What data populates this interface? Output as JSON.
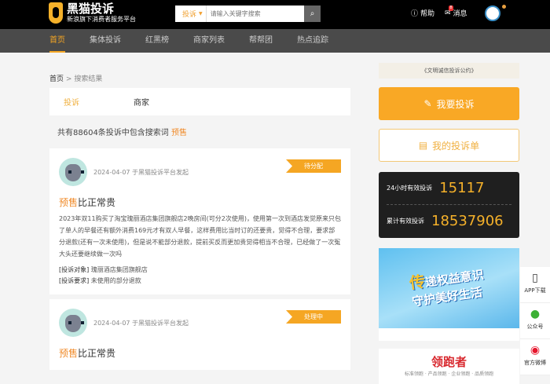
{
  "header": {
    "logo_title": "黑猫投诉",
    "logo_subtitle": "新浪旗下消费者服务平台",
    "search_type": "投诉",
    "search_placeholder": "请输入关键字搜索",
    "help": "帮助",
    "messages": "消息",
    "message_count": "8"
  },
  "nav": [
    "首页",
    "集体投诉",
    "红黑榜",
    "商家列表",
    "帮帮团",
    "热点追踪"
  ],
  "breadcrumb": {
    "home": "首页",
    "sep": ">",
    "current": "搜索结果"
  },
  "tabs": [
    "投诉",
    "商家"
  ],
  "result_count": {
    "prefix": "共有88604条投诉中包含搜索词",
    "keyword": "预售"
  },
  "complaints": [
    {
      "date": "2024-04-07 于黑猫投诉平台发起",
      "status": "待分配",
      "title_hl": "预售",
      "title_rest": "比正常贵",
      "body": "2023年双11购买了淘宝瑰丽酒店集团旗舰店2晚房间(可分2次使用)，使用第一次到酒店发觉原来只包了单人的早餐还有额外消费169元才有双人早餐，这样费用比当时订的还要贵，觉得不合理，要求部分退款(还有一次未使用)，但是说不能部分退款，提前买反而更加贵觉得相当不合理，已经做了一次冤大头还要继续做一次吗",
      "target_label": "[投诉对象]",
      "target": "瑰丽酒店集团旗舰店",
      "demand_label": "[投诉要求]",
      "demand": "未使用的部分退款"
    },
    {
      "date": "2024-04-07 于黑猫投诉平台发起",
      "status": "处理中",
      "title_hl": "预售",
      "title_rest": "比正常贵"
    }
  ],
  "sidebar": {
    "pact": "《文明诚信投诉公约》",
    "complain_btn": "我要投诉",
    "my_list_btn": "我的投诉单",
    "stat1_label": "24小时有效投诉",
    "stat1_value": "15117",
    "stat2_label": "累计有效投诉",
    "stat2_value": "18537906",
    "banner_line1_a": "传",
    "banner_line1_b": "递权益意识",
    "banner_line2": "守护美好生活",
    "ad_title": "领跑者",
    "ad_sub": "标准领跑 · 产品领跑 · 企业领跑 · 品质领跑"
  },
  "float": {
    "app": "APP下载",
    "wechat": "公众号",
    "weibo": "官方微博"
  }
}
